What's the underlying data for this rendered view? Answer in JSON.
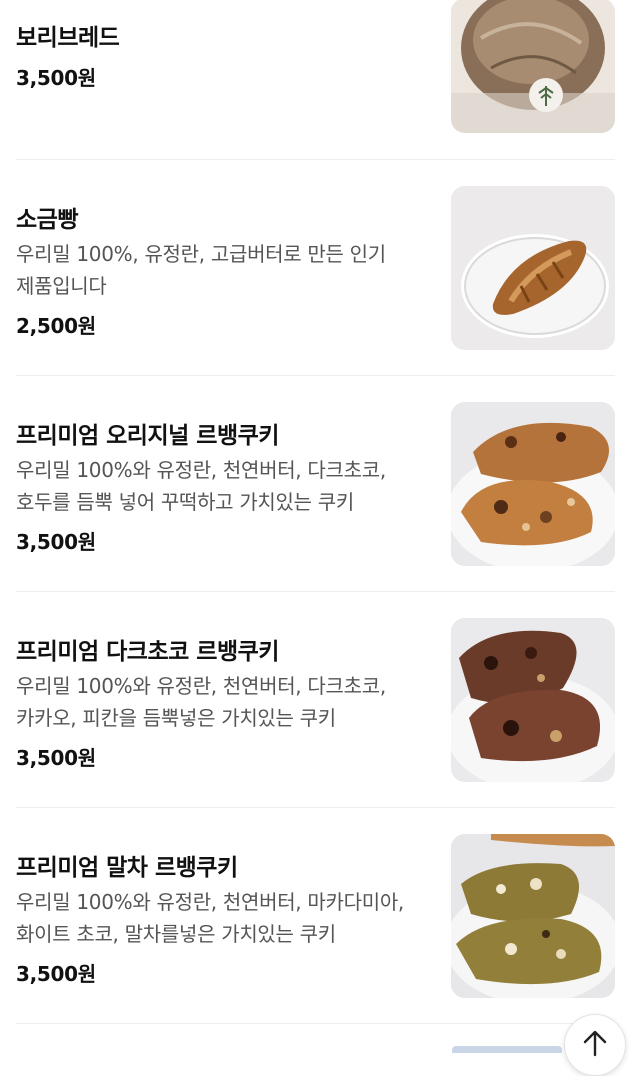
{
  "menu_items": [
    {
      "name": "보리브레드",
      "desc_line1": "",
      "desc_line2": "",
      "price": "3,500원",
      "image": "barley-bread-photo"
    },
    {
      "name": "소금빵",
      "desc_line1": "우리밀 100%, 유정란, 고급버터로 만든 인기",
      "desc_line2": "제품입니다",
      "price": "2,500원",
      "image": "salt-bread-photo"
    },
    {
      "name": "프리미엄 오리지널 르뱅쿠키",
      "desc_line1": "우리밀 100%와 유정란, 천연버터, 다크초코,",
      "desc_line2": "호두를 듬뿍 넣어 꾸떡하고 가치있는 쿠키",
      "price": "3,500원",
      "image": "original-levain-cookie-photo"
    },
    {
      "name": "프리미엄 다크초코 르뱅쿠키",
      "desc_line1": "우리밀 100%와 유정란, 천연버터, 다크초코,",
      "desc_line2": "카카오, 피칸을 듬뿍넣은 가치있는 쿠키",
      "price": "3,500원",
      "image": "dark-choco-levain-cookie-photo"
    },
    {
      "name": "프리미엄 말차 르뱅쿠키",
      "desc_line1": "우리밀 100%와 유정란, 천연버터, 마카다미아,",
      "desc_line2": "화이트 초코, 말차를넣은 가치있는 쿠키",
      "price": "3,500원",
      "image": "matcha-levain-cookie-photo"
    }
  ],
  "scroll_top": {
    "icon": "arrow-up-icon"
  }
}
